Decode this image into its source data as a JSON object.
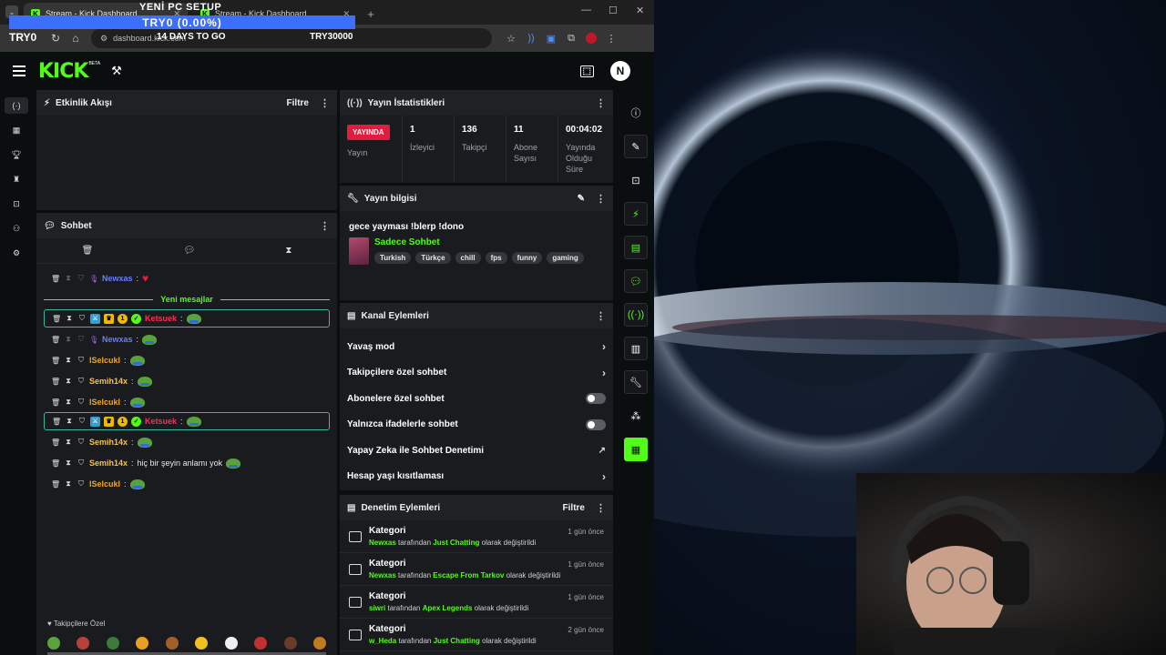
{
  "browser": {
    "tabs": [
      {
        "title": "Stream - Kick Dashboard",
        "active": true
      },
      {
        "title": "Stream - Kick Dashboard",
        "active": false
      }
    ],
    "url": "dashboard.kick.com",
    "window_controls": [
      "—",
      "☐",
      "✕"
    ]
  },
  "overlay": {
    "title": "YENİ PC SETUP",
    "progress_label": "TRY0 (0.00%)",
    "progress_fraction": 0.0,
    "current_amount": "TRY0",
    "days_left": "14 DAYS TO GO",
    "goal_amount": "TRY30000"
  },
  "app": {
    "logo": "KICK",
    "beta": "BETA",
    "user_initial": "N"
  },
  "activity": {
    "title": "Etkinlik Akışı",
    "filter": "Filtre"
  },
  "chat": {
    "title": "Sohbet",
    "new_messages": "Yeni mesajlar",
    "footer_label": "Takipçilere Özel",
    "messages": [
      {
        "user": "Newxas",
        "text": "",
        "color": "#6a7dff",
        "highlight": false,
        "dim": true
      },
      {
        "user": "Ketsuek",
        "text": "",
        "color": "#ff2d55",
        "highlight": true,
        "dim": false
      },
      {
        "user": "Newxas",
        "text": "",
        "color": "#6a7dff",
        "highlight": false,
        "dim": true
      },
      {
        "user": "lSelcukl",
        "text": "",
        "color": "#f5a623",
        "highlight": false,
        "dim": false
      },
      {
        "user": "Semih14x",
        "text": "",
        "color": "#f5c04a",
        "highlight": false,
        "dim": false
      },
      {
        "user": "lSelcukl",
        "text": "",
        "color": "#f5a623",
        "highlight": false,
        "dim": false
      },
      {
        "user": "Ketsuek",
        "text": "",
        "color": "#ff2d55",
        "highlight": true,
        "dim": false
      },
      {
        "user": "Semih14x",
        "text": "",
        "color": "#f5c04a",
        "highlight": false,
        "dim": false
      },
      {
        "user": "Semih14x",
        "text": "hiç bir şeyin anlamı yok",
        "color": "#f5c04a",
        "highlight": false,
        "dim": false
      },
      {
        "user": "lSelcukl",
        "text": "",
        "color": "#f5a623",
        "highlight": false,
        "dim": false
      }
    ]
  },
  "stats": {
    "title": "Yayın İstatistikleri",
    "live_badge": "YAYINDA",
    "items": [
      {
        "value": "",
        "label": "Yayın"
      },
      {
        "value": "1",
        "label": "İzleyici"
      },
      {
        "value": "136",
        "label": "Takipçi"
      },
      {
        "value": "11",
        "label": "Abone Sayısı"
      },
      {
        "value": "00:04:02",
        "label": "Yayında Olduğu Süre"
      }
    ]
  },
  "stream_info": {
    "title": "Yayın bilgisi",
    "stream_title": "gece yayması !blerp !dono",
    "category": "Sadece Sohbet",
    "tags": [
      "Turkish",
      "Türkçe",
      "chill",
      "fps",
      "funny",
      "gaming"
    ]
  },
  "channel_actions": {
    "title": "Kanal Eylemleri",
    "items": [
      {
        "label": "Yavaş mod",
        "kind": "arrow"
      },
      {
        "label": "Takipçilere özel sohbet",
        "kind": "arrow"
      },
      {
        "label": "Abonelere özel sohbet",
        "kind": "toggle"
      },
      {
        "label": "Yalnızca ifadelerle sohbet",
        "kind": "toggle"
      },
      {
        "label": "Yapay Zeka ile Sohbet Denetimi",
        "kind": "external"
      },
      {
        "label": "Hesap yaşı kısıtlaması",
        "kind": "arrow"
      }
    ]
  },
  "moderation": {
    "title": "Denetim Eylemleri",
    "filter": "Filtre",
    "items": [
      {
        "title": "Kategori",
        "user": "Newxas",
        "mid": "tarafından",
        "category": "Just Chatting",
        "tail": "olarak değiştirildi",
        "time": "1 gün önce"
      },
      {
        "title": "Kategori",
        "user": "Newxas",
        "mid": "tarafından",
        "category": "Escape From Tarkov",
        "tail": "olarak değiştirildi",
        "time": "1 gün önce"
      },
      {
        "title": "Kategori",
        "user": "siwri",
        "mid": "tarafından",
        "category": "Apex Legends",
        "tail": "olarak değiştirildi",
        "time": "1 gün önce"
      },
      {
        "title": "Kategori",
        "user": "w_Heda",
        "mid": "tarafından",
        "category": "Just Chatting",
        "tail": "olarak değiştirildi",
        "time": "2 gün önce"
      }
    ]
  }
}
